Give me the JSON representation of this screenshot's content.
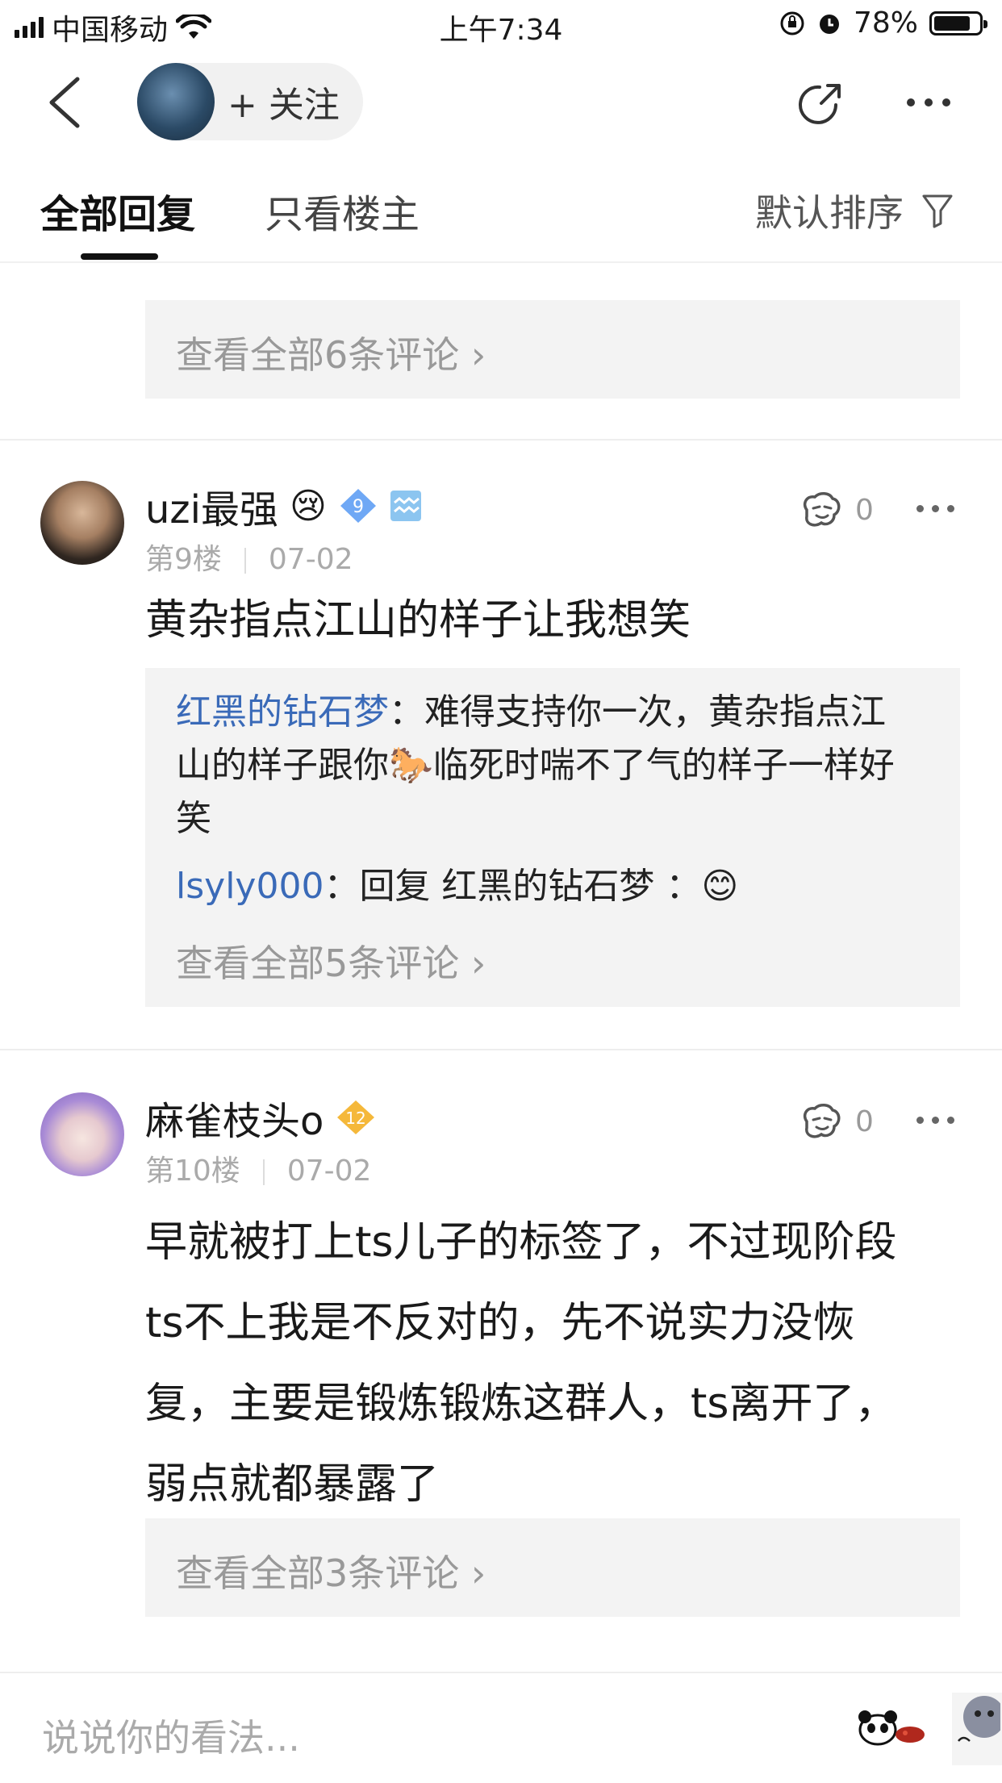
{
  "status_bar": {
    "carrier": "中国移动",
    "time": "上午7:34",
    "battery": "78%",
    "battery_level": 0.78
  },
  "nav": {
    "follow_label": "+ 关注"
  },
  "tabs": {
    "all_replies": "全部回复",
    "op_only": "只看楼主",
    "sort_label": "默认排序"
  },
  "prev_post": {
    "view_all": "查看全部6条评论"
  },
  "posts": [
    {
      "username": "uzi最强",
      "username_emoji": "😢",
      "level_badge": "9",
      "floor": "第9楼",
      "date": "07-02",
      "likes": "0",
      "content_lines": [
        "黄杂指点江山的样子让我想笑"
      ],
      "sub_comments": [
        {
          "author": "红黑的钻石梦",
          "sep": "：",
          "lines": [
            "难得支持你一次，黄杂指点江",
            "山的样子跟你🐎临死时喘不了气的样子一样好",
            "笑"
          ]
        },
        {
          "author": "lsyly000",
          "sep": "：",
          "lines": [
            "回复 红黑的钻石梦 ：😊"
          ]
        }
      ],
      "view_all": "查看全部5条评论"
    },
    {
      "username": "麻雀枝头o",
      "level_badge": "12",
      "floor": "第10楼",
      "date": "07-02",
      "likes": "0",
      "content_lines": [
        "早就被打上ts儿子的标签了，不过现阶段",
        "ts不上我是不反对的，先不说实力没恢",
        "复，主要是锻炼锻炼这群人，ts离开了，",
        "弱点就都暴露了"
      ],
      "view_all": "查看全部3条评论"
    }
  ],
  "composer": {
    "placeholder": "说说你的看法..."
  },
  "colors": {
    "link_blue": "#3a6ab8",
    "badge_blue": "#6fa8f5",
    "badge_gold": "#f5b83a"
  }
}
